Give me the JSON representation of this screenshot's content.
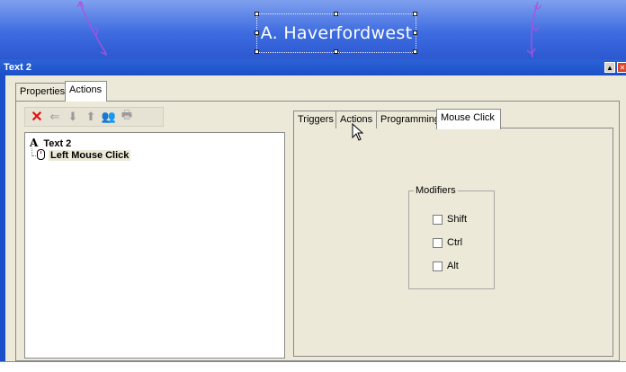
{
  "canvas": {
    "caption": "A. Haverfordwest",
    "background_color": "#3e6ce0",
    "decoration_color": "#b050e0"
  },
  "window": {
    "title": "Text 2",
    "minimize_icon": "scroll-up-icon",
    "close_icon": "close-icon"
  },
  "outer_tabs": [
    {
      "label": "Properties",
      "active": false
    },
    {
      "label": "Actions",
      "active": true
    }
  ],
  "toolbar": {
    "icons": [
      "delete-icon",
      "left-arrow-icon",
      "down-arrow-icon",
      "up-arrow-icon",
      "people-icon",
      "print-icon"
    ]
  },
  "tree": {
    "root_glyph": "A",
    "root_label": "Text 2",
    "child_label": "Left Mouse Click"
  },
  "inner_tabs": [
    {
      "label": "Triggers",
      "active": false
    },
    {
      "label": "Actions",
      "active": false
    },
    {
      "label": "Programming",
      "active": false
    },
    {
      "label": "Mouse Click",
      "active": true
    }
  ],
  "modifiers": {
    "title": "Modifiers",
    "options": [
      {
        "label": "Shift",
        "checked": false
      },
      {
        "label": "Ctrl",
        "checked": false
      },
      {
        "label": "Alt",
        "checked": false
      }
    ]
  }
}
